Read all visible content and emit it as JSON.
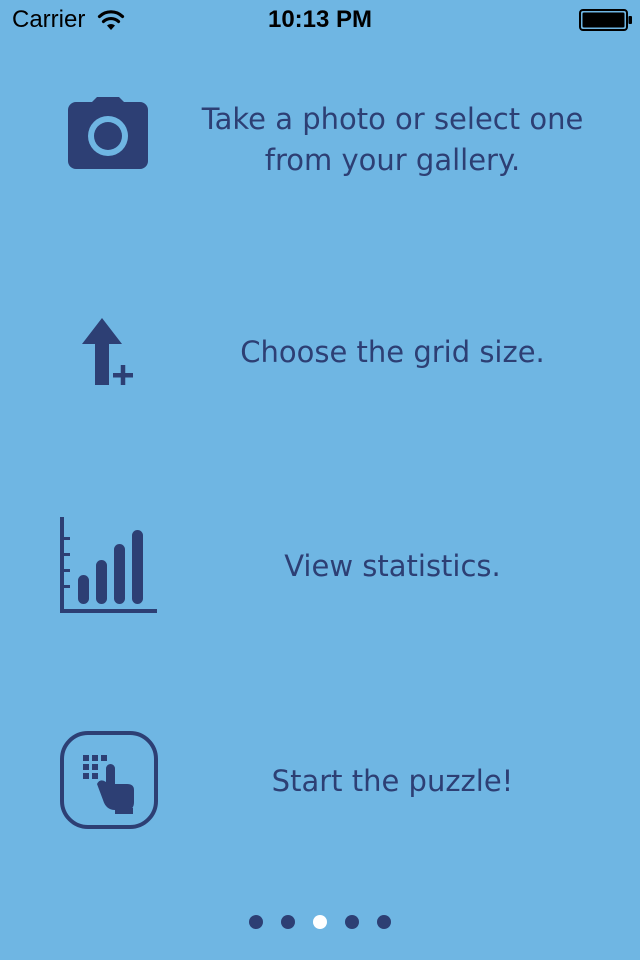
{
  "status_bar": {
    "carrier": "Carrier",
    "time": "10:13 PM",
    "wifi_icon": "wifi-icon",
    "battery_icon": "battery-icon"
  },
  "colors": {
    "background": "#6fb6e3",
    "accent": "#2d3f74",
    "active_dot": "#ffffff"
  },
  "features": [
    {
      "icon": "camera-icon",
      "text": "Take a photo or select one from your gallery."
    },
    {
      "icon": "grid-size-increase-icon",
      "text": "Choose the grid size."
    },
    {
      "icon": "bar-chart-icon",
      "text": "View statistics."
    },
    {
      "icon": "tap-puzzle-icon",
      "text": "Start the puzzle!"
    }
  ],
  "pagination": {
    "total": 5,
    "current": 3
  }
}
